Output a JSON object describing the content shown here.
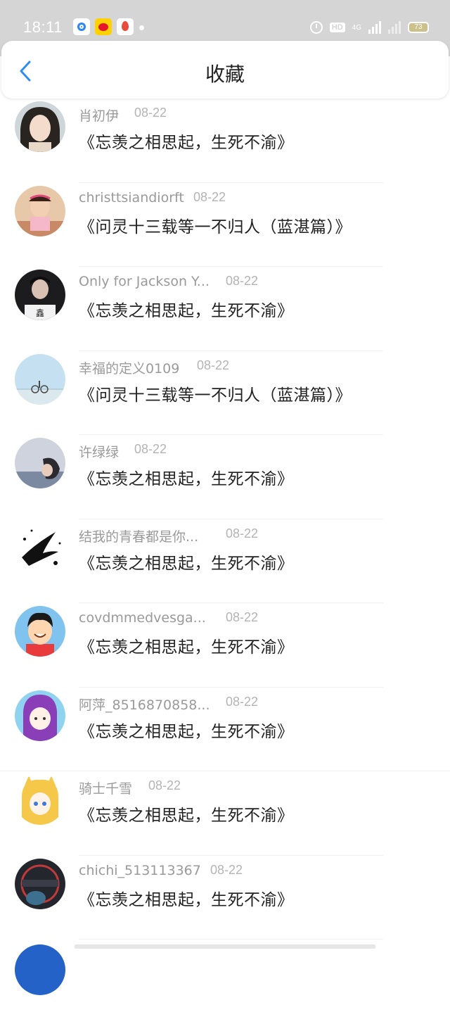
{
  "status_bar": {
    "time": "18:11",
    "hd": "HD",
    "network": "4G",
    "battery": "73",
    "app_icons": [
      "browser-icon",
      "weibo-icon",
      "map-icon"
    ]
  },
  "header": {
    "title": "收藏",
    "back_icon": "chevron-left-icon"
  },
  "colors": {
    "accent": "#2e8ef0",
    "status_bar": "#d5d5d5",
    "meta_text": "#9a9a9a"
  },
  "items": [
    {
      "name": "肖初伊",
      "date": "08-22",
      "title": "《忘羡之相思起，生死不渝》"
    },
    {
      "name": "christtsiandiorft",
      "date": "08-22",
      "title": "《问灵十三载等一不归人（蓝湛篇）》"
    },
    {
      "name": "Only for Jackson Y...",
      "date": "08-22",
      "title": "《忘羡之相思起，生死不渝》"
    },
    {
      "name": "幸福的定义0109",
      "date": "08-22",
      "title": "《问灵十三载等一不归人（蓝湛篇）》"
    },
    {
      "name": "许绿绿",
      "date": "08-22",
      "title": "《忘羡之相思起，生死不渝》"
    },
    {
      "name": "结我的青春都是你...",
      "date": "08-22",
      "title": "《忘羡之相思起，生死不渝》"
    },
    {
      "name": "covdmmedvesga...",
      "date": "08-22",
      "title": "《忘羡之相思起，生死不渝》"
    },
    {
      "name": "阿萍_8516870858...",
      "date": "08-22",
      "title": "《忘羡之相思起，生死不渝》"
    },
    {
      "name": "骑士千雪",
      "date": "08-22",
      "title": "《忘羡之相思起，生死不渝》"
    },
    {
      "name": "chichi_513113367",
      "date": "08-22",
      "title": "《忘羡之相思起，生死不渝》"
    }
  ]
}
